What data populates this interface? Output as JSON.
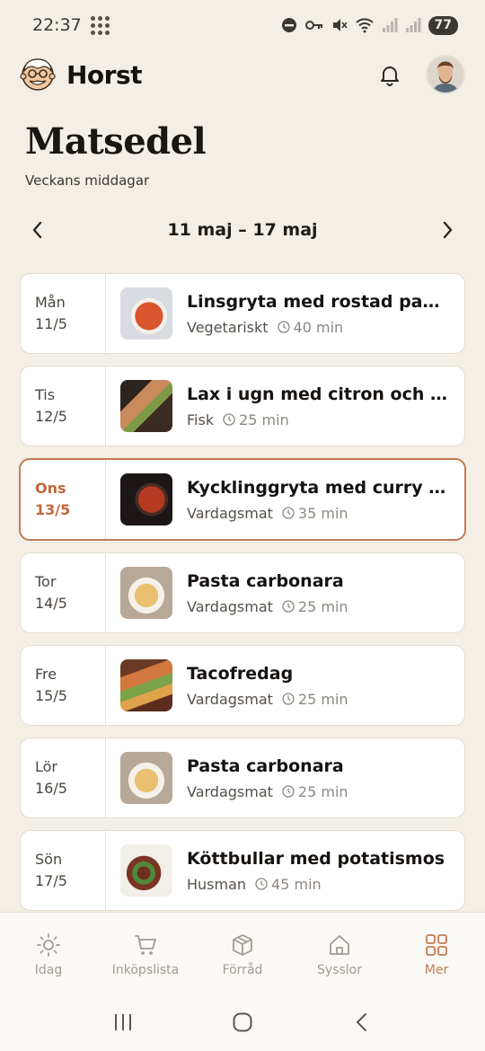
{
  "status": {
    "time": "22:37",
    "battery": "77"
  },
  "app": {
    "name": "Horst"
  },
  "page": {
    "title": "Matsedel",
    "subtitle": "Veckans middagar"
  },
  "week": {
    "label": "11 maj – 17 maj"
  },
  "meals": [
    {
      "day": "Mån",
      "date": "11/5",
      "dish": "Linsgryta med rostad paprika",
      "category": "Vegetariskt",
      "time": "40 min",
      "today": false,
      "thumb": "t-soup"
    },
    {
      "day": "Tis",
      "date": "12/5",
      "dish": "Lax i ugn med citron och dill",
      "category": "Fisk",
      "time": "25 min",
      "today": false,
      "thumb": "t-salmon"
    },
    {
      "day": "Ons",
      "date": "13/5",
      "dish": "Kycklinggryta med curry oc...",
      "category": "Vardagsmat",
      "time": "35 min",
      "today": true,
      "thumb": "t-curry"
    },
    {
      "day": "Tor",
      "date": "14/5",
      "dish": "Pasta carbonara",
      "category": "Vardagsmat",
      "time": "25 min",
      "today": false,
      "thumb": "t-pasta"
    },
    {
      "day": "Fre",
      "date": "15/5",
      "dish": "Tacofredag",
      "category": "Vardagsmat",
      "time": "25 min",
      "today": false,
      "thumb": "t-taco"
    },
    {
      "day": "Lör",
      "date": "16/5",
      "dish": "Pasta carbonara",
      "category": "Vardagsmat",
      "time": "25 min",
      "today": false,
      "thumb": "t-pasta"
    },
    {
      "day": "Sön",
      "date": "17/5",
      "dish": "Köttbullar med potatismos",
      "category": "Husman",
      "time": "45 min",
      "today": false,
      "thumb": "t-meat"
    }
  ],
  "nav": [
    {
      "label": "Idag",
      "icon": "sun-icon",
      "active": false
    },
    {
      "label": "Inköpslista",
      "icon": "cart-icon",
      "active": false
    },
    {
      "label": "Förråd",
      "icon": "box-icon",
      "active": false
    },
    {
      "label": "Sysslor",
      "icon": "house-icon",
      "active": false
    },
    {
      "label": "Mer",
      "icon": "grid-icon",
      "active": true
    }
  ],
  "colors": {
    "background": "#f3efe6",
    "accent": "#c47a52",
    "card": "#ffffff"
  }
}
